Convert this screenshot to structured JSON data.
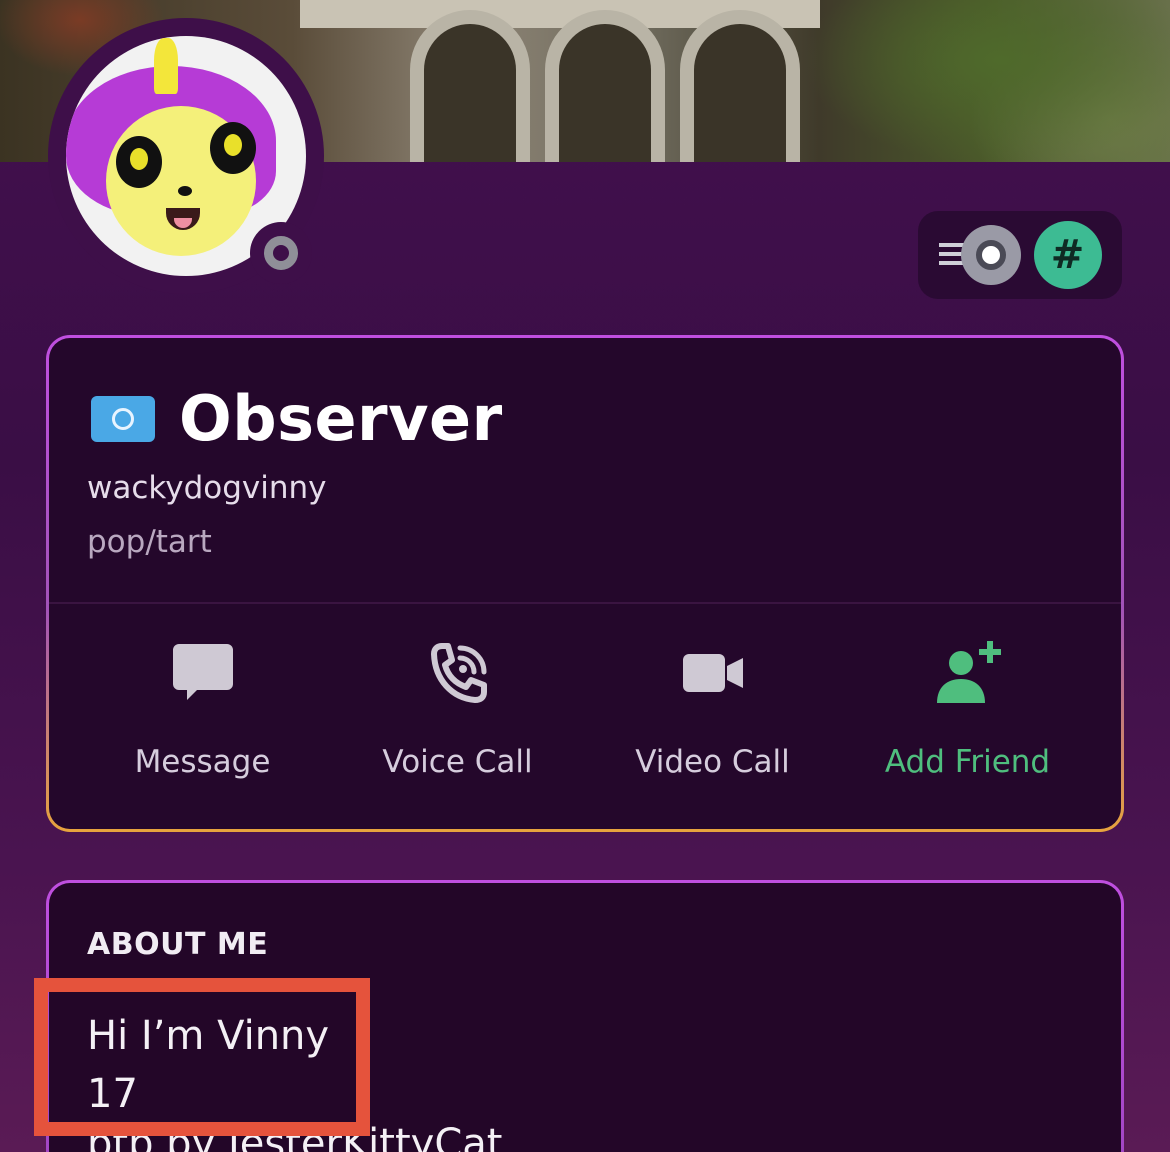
{
  "profile": {
    "display_name": "Observer",
    "username": "wackydogvinny",
    "pronouns": "pop/tart",
    "flag_icon": "un-flag-icon",
    "status": "offline"
  },
  "badges": [
    {
      "icon": "speed-badge-icon"
    },
    {
      "icon": "hashtag-badge-icon",
      "text": "#"
    }
  ],
  "actions": {
    "message": "Message",
    "voice_call": "Voice Call",
    "video_call": "Video Call",
    "add_friend": "Add Friend"
  },
  "about": {
    "title": "ABOUT ME",
    "lines": "Hi I’m Vinny\n17",
    "more": "ptp by JesterKittyCat"
  },
  "colors": {
    "accent_green": "#4fbe7e",
    "highlight_red": "#e5533c",
    "background": "#3a0e45"
  }
}
